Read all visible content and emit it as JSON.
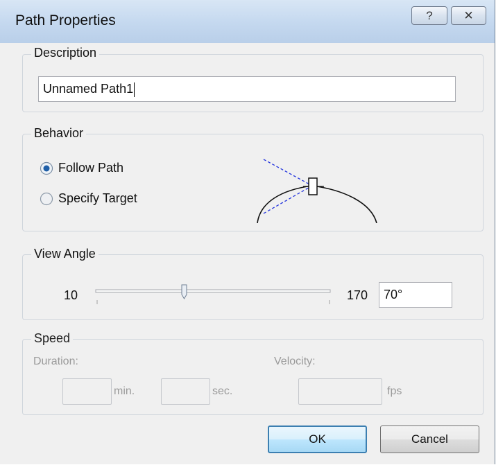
{
  "window": {
    "title": "Path Properties",
    "help_glyph": "?",
    "close_glyph": "✕",
    "help_icon": "help-icon",
    "close_icon": "close-icon"
  },
  "description": {
    "group_label": "Description",
    "value": "Unnamed Path1"
  },
  "behavior": {
    "group_label": "Behavior",
    "options": [
      {
        "label": "Follow Path",
        "selected": true
      },
      {
        "label": "Specify Target",
        "selected": false
      }
    ],
    "diagram_icon": "path-view-diagram-icon"
  },
  "view_angle": {
    "group_label": "View Angle",
    "min_label": "10",
    "max_label": "170",
    "value": "70°",
    "slider_min": 10,
    "slider_max": 170,
    "slider_value": 70
  },
  "speed": {
    "group_label": "Speed",
    "duration_label": "Duration:",
    "velocity_label": "Velocity:",
    "min_value": "",
    "min_unit": "min.",
    "sec_value": "",
    "sec_unit": "sec.",
    "velocity_value": "",
    "velocity_unit": "fps"
  },
  "buttons": {
    "ok": "OK",
    "cancel": "Cancel"
  },
  "colors": {
    "accent": "#3c7fb1",
    "radio_selected": "#1f5fa8",
    "diagram_dash": "#2233dd"
  }
}
